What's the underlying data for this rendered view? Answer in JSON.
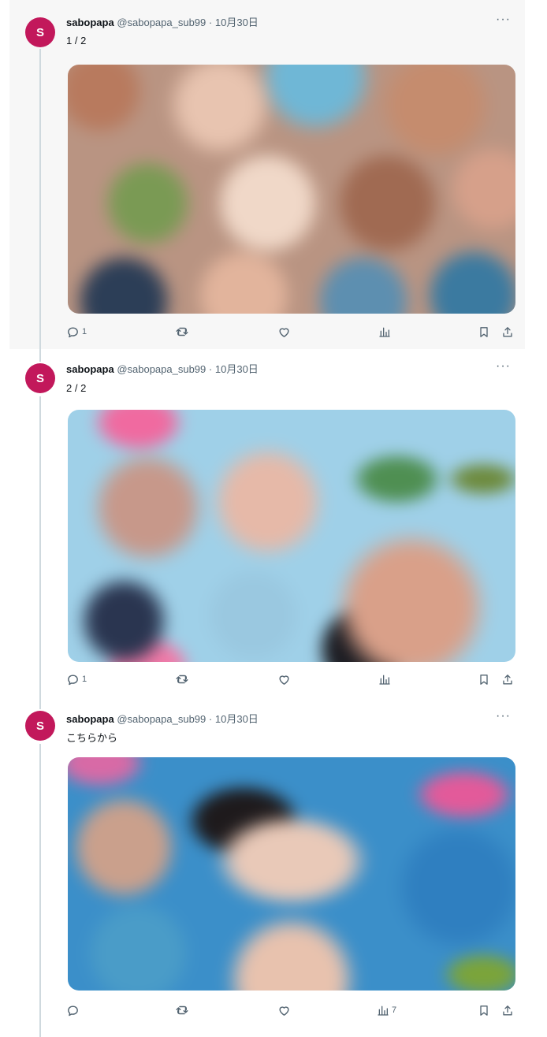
{
  "tweets": [
    {
      "avatar_letter": "S",
      "name": "sabopapa",
      "handle": "@sabopapa_sub99",
      "separator": "·",
      "date": "10月30日",
      "more": "···",
      "text": "1 / 2",
      "replies": "1",
      "views": ""
    },
    {
      "avatar_letter": "S",
      "name": "sabopapa",
      "handle": "@sabopapa_sub99",
      "separator": "·",
      "date": "10月30日",
      "more": "···",
      "text": "2 / 2",
      "replies": "1",
      "views": ""
    },
    {
      "avatar_letter": "S",
      "name": "sabopapa",
      "handle": "@sabopapa_sub99",
      "separator": "·",
      "date": "10月30日",
      "more": "···",
      "text": "こちらから",
      "replies": "",
      "views": "7"
    }
  ],
  "colors": {
    "avatar": "#c2185b",
    "highlight_bg": "#f7f7f7",
    "muted_text": "#536471",
    "thread_line": "#cfd9de"
  }
}
